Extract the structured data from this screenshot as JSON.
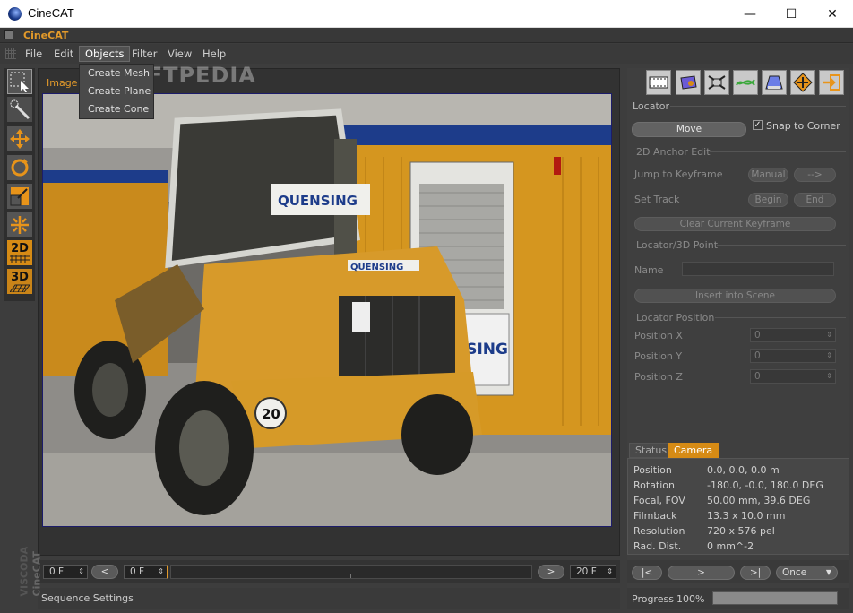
{
  "window": {
    "title": "CineCAT",
    "min": "—",
    "max": "☐",
    "close": "✕"
  },
  "app_label": "CineCAT",
  "menu": [
    "File",
    "Edit",
    "Objects",
    "Filter",
    "View",
    "Help"
  ],
  "dropdown": [
    "Create Mesh",
    "Create Plane",
    "Create Cone"
  ],
  "watermark": "SOFTPEDIA",
  "viewport_label": "Image",
  "timeline": {
    "start": "0 F",
    "prev": "<",
    "current": "0 F",
    "next": ">",
    "end": "20 F"
  },
  "status_text": "Sequence Settings",
  "right": {
    "locator_title": "Locator",
    "move_btn": "Move",
    "snap_label": "Snap to Corner",
    "anchor_title": "2D Anchor Edit",
    "jump_label": "Jump to Keyframe",
    "manual_btn": "Manual",
    "arrow_btn": "-->",
    "set_track_label": "Set Track",
    "begin_btn": "Begin",
    "end_btn": "End",
    "clear_btn": "Clear Current Keyframe",
    "point_title": "Locator/3D Point",
    "name_label": "Name",
    "insert_btn": "Insert into Scene",
    "pos_title": "Locator Position",
    "pos_x_label": "Position X",
    "pos_y_label": "Position Y",
    "pos_z_label": "Position Z",
    "pos_x": "0",
    "pos_y": "0",
    "pos_z": "0"
  },
  "tabs": {
    "status": "Status",
    "camera": "Camera"
  },
  "camera": [
    {
      "k": "Position",
      "v": "0.0, 0.0, 0.0 m"
    },
    {
      "k": "Rotation",
      "v": "-180.0, -0.0, 180.0 DEG"
    },
    {
      "k": "Focal, FOV",
      "v": "50.00 mm, 39.6 DEG"
    },
    {
      "k": "Filmback",
      "v": "13.3 x 10.0 mm"
    },
    {
      "k": "Resolution",
      "v": "720 x 576 pel"
    },
    {
      "k": "Rad. Dist.",
      "v": "0 mm^-2"
    }
  ],
  "playback": {
    "first": "|<",
    "play": ">",
    "last": ">|",
    "mode": "Once"
  },
  "progress": {
    "label": "Progress",
    "percent": "100%",
    "value": 1.0
  },
  "brand": {
    "vendor": "VISCODA",
    "product": "CineCAT"
  },
  "photo_signs": {
    "sign1": "QUENSING",
    "sign2": "QUENSING",
    "sign3": "NSING",
    "plate": "20"
  },
  "colors": {
    "accent": "#d68b15",
    "panel": "#3f3f3f",
    "bg": "#3d3d3d"
  }
}
